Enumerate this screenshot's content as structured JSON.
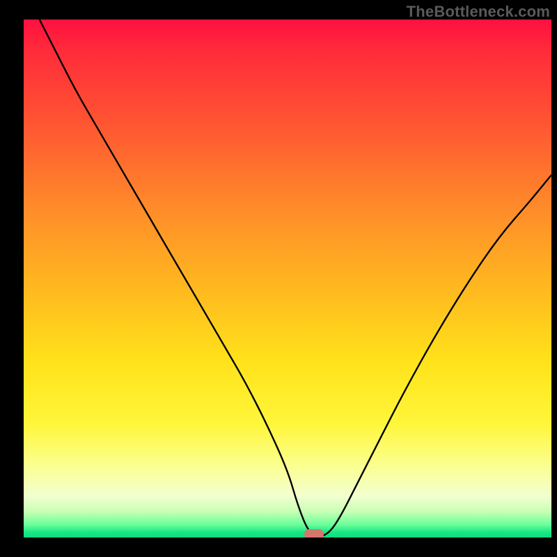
{
  "watermark": "TheBottleneck.com",
  "palette": {
    "page_bg": "#000000",
    "curve_stroke": "#000000",
    "min_marker": "#d4776f",
    "gradient_stops": [
      "#ff1040",
      "#ff5532",
      "#ffb91f",
      "#ffe21a",
      "#fbff8e",
      "#6bff9a",
      "#0fdc7e"
    ]
  },
  "chart_data": {
    "type": "line",
    "title": "",
    "xlabel": "",
    "ylabel": "",
    "xlim": [
      0,
      100
    ],
    "ylim": [
      0,
      100
    ],
    "grid": false,
    "legend": false,
    "annotations": {
      "watermark": "TheBottleneck.com",
      "minimum_marker": {
        "x": 55,
        "y": 0,
        "note": "rounded marker at curve minimum"
      }
    },
    "background": {
      "type": "vertical-gradient",
      "description": "red (top, high) → orange → yellow → pale yellow → green (bottom, low)"
    },
    "series": [
      {
        "name": "curve",
        "note": "V-shaped bottleneck curve; left branch starts at top-left, right branch rises toward upper-right. Values estimated from pixel positions (y: 0 = bottom/good, 100 = top/bad).",
        "x": [
          3,
          6,
          10,
          14,
          18,
          22,
          26,
          30,
          34,
          38,
          42,
          46,
          50,
          52,
          54,
          56,
          58,
          60,
          63,
          67,
          72,
          78,
          84,
          90,
          96,
          100
        ],
        "y": [
          100,
          94,
          86,
          79,
          72,
          65,
          58,
          51,
          44,
          37,
          30,
          22,
          13,
          6,
          1,
          0,
          1,
          4,
          10,
          18,
          28,
          39,
          49,
          58,
          65,
          70
        ]
      }
    ]
  }
}
